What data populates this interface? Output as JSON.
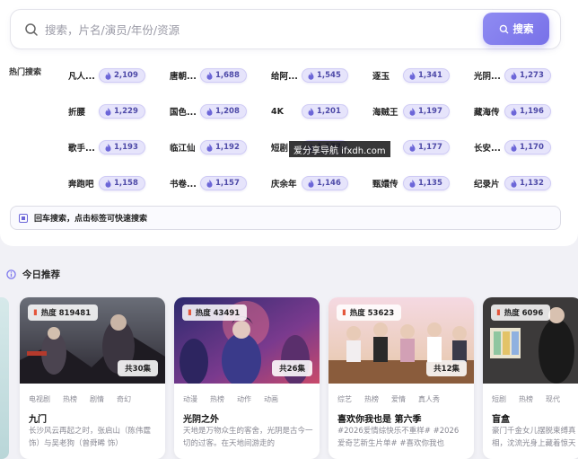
{
  "search": {
    "placeholder": "搜索，片名/演员/年份/资源",
    "button_label": "搜索"
  },
  "hot_search": {
    "label": "热门搜索",
    "tags": [
      {
        "name": "凡人...",
        "count": "2,109"
      },
      {
        "name": "唐朝...",
        "count": "1,688"
      },
      {
        "name": "给阿...",
        "count": "1,545"
      },
      {
        "name": "逐玉",
        "count": "1,341"
      },
      {
        "name": "光阴...",
        "count": "1,273"
      },
      {
        "name": "折腰",
        "count": "1,229"
      },
      {
        "name": "国色...",
        "count": "1,208"
      },
      {
        "name": "4K",
        "count": "1,201"
      },
      {
        "name": "海贼王",
        "count": "1,197"
      },
      {
        "name": "藏海传",
        "count": "1,196"
      },
      {
        "name": "歌手...",
        "count": "1,193"
      },
      {
        "name": "临江仙",
        "count": "1,192"
      },
      {
        "name": "短剧",
        "count": "1,177"
      },
      {
        "name": "",
        "count": "1,177"
      },
      {
        "name": "长安...",
        "count": "1,170"
      },
      {
        "name": "奔跑吧",
        "count": "1,158"
      },
      {
        "name": "书卷...",
        "count": "1,157"
      },
      {
        "name": "庆余年",
        "count": "1,146"
      },
      {
        "name": "甄嬛传",
        "count": "1,135"
      },
      {
        "name": "纪录片",
        "count": "1,132"
      }
    ]
  },
  "tip": "回车搜索，点击标签可快速搜索",
  "watermark": "爱分享导航 ifxdh.com",
  "today": {
    "title": "今日推荐",
    "cards": [
      {
        "heat": "热度 819481",
        "episodes": "共30集",
        "tags": [
          "电视剧",
          "热榜",
          "剧情",
          "奇幻"
        ],
        "title": "九门",
        "desc": "长沙风云再起之时，张启山（陈伟霆 饰）与吴老狗（曾舜晞 饰）"
      },
      {
        "heat": "热度 43491",
        "episodes": "共26集",
        "tags": [
          "动漫",
          "热榜",
          "动作",
          "动画"
        ],
        "title": "光阴之外",
        "desc": "天地是万物众生的客舍，光阴是古今一切的过客。在天地间游走的"
      },
      {
        "heat": "热度 53623",
        "episodes": "共12集",
        "tags": [
          "综艺",
          "热榜",
          "爱情",
          "真人秀"
        ],
        "title": "喜欢你我也是 第六季",
        "desc": "#2026爱情综快乐不重样# #2026 爱奇艺新生片单# #喜欢你我也"
      },
      {
        "heat": "热度 6096",
        "episodes": "",
        "tags": [
          "短剧",
          "热榜",
          "现代"
        ],
        "title": "盲盒",
        "desc": "豪门千金女儿摆脱束缚真相，沈流光身上藏着惊天秘密，沈流光身"
      }
    ]
  },
  "colors": {
    "accent": "#7f79ee",
    "pill_bg": "#e6e4fb",
    "page_bg": "#f1f1f6"
  }
}
